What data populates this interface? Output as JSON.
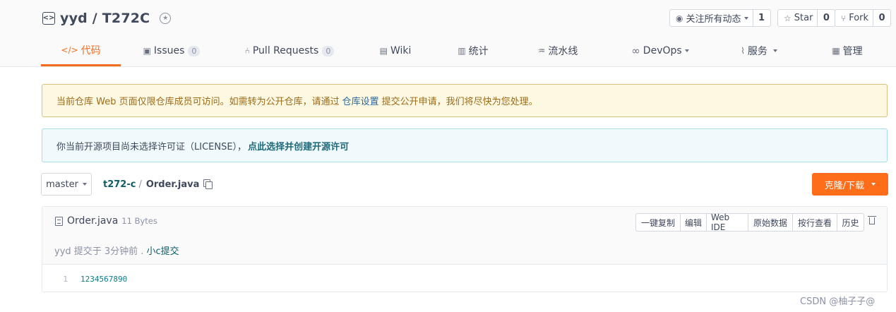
{
  "repo": {
    "title": "yyd / T272C"
  },
  "actions": {
    "watch": {
      "label": "关注所有动态",
      "count": "1"
    },
    "star": {
      "label": "Star",
      "count": "0"
    },
    "fork": {
      "label": "Fork",
      "count": "0"
    }
  },
  "tabs": [
    {
      "label": "代码",
      "icon": "code-icon",
      "active": true
    },
    {
      "label": "Issues",
      "count": "0",
      "icon": "issues-icon"
    },
    {
      "label": "Pull Requests",
      "count": "0",
      "icon": "pull-request-icon"
    },
    {
      "label": "Wiki",
      "icon": "wiki-icon"
    },
    {
      "label": "统计",
      "icon": "stats-icon"
    },
    {
      "label": "流水线",
      "icon": "pipeline-icon"
    },
    {
      "label": "DevOps",
      "icon": "devops-icon"
    },
    {
      "label": "服务",
      "icon": "service-icon"
    },
    {
      "label": "管理",
      "icon": "manage-icon"
    }
  ],
  "alerts": {
    "warning": {
      "prefix": "当前仓库 Web 页面仅限仓库成员可访问。如需转为公开仓库，请通过",
      "link": "仓库设置",
      "suffix": "提交公开申请，我们将尽快为您处理。"
    },
    "info": {
      "text": "你当前开源项目尚未选择许可证（LICENSE），",
      "link": "点此选择并创建开源许可"
    }
  },
  "branch": {
    "name": "master"
  },
  "breadcrumb": {
    "repo": "t272-c",
    "separator": "/",
    "file": "Order.java"
  },
  "clone": {
    "label": "克隆/下载"
  },
  "file": {
    "name": "Order.java",
    "size": "11 Bytes",
    "buttons": [
      "一键复制",
      "编辑",
      "Web IDE",
      "原始数据",
      "按行查看",
      "历史"
    ],
    "commit": {
      "text": "yyd 提交于 3分钟前 .",
      "message": "小c提交"
    },
    "lines": [
      {
        "no": "1",
        "code": "1234567890"
      }
    ]
  },
  "watermark": "CSDN @柚子子@",
  "colors": {
    "accent": "#fe6d1a",
    "link": "#0f5d68"
  }
}
